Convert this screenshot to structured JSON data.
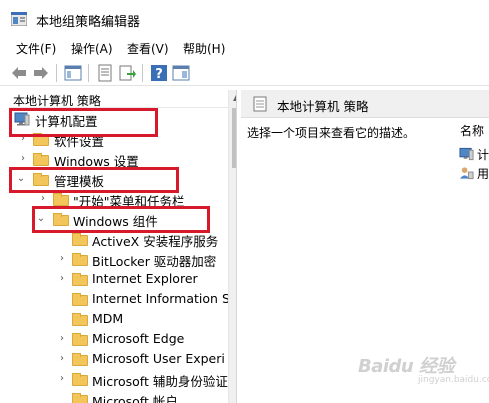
{
  "window": {
    "title": "本地组策略编辑器"
  },
  "menu": [
    "文件(F)",
    "操作(A)",
    "查看(V)",
    "帮助(H)"
  ],
  "left_pane": {
    "header": "本地计算机 策略",
    "tree": [
      {
        "label": "计算机配置",
        "icon": "computer-icon",
        "expander": ""
      },
      {
        "label": "软件设置",
        "icon": "folder-icon",
        "expander": "chevron-right"
      },
      {
        "label": "Windows 设置",
        "icon": "folder-icon",
        "expander": "chevron-right"
      },
      {
        "label": "管理模板",
        "icon": "folder-icon",
        "expander": "chevron-down"
      },
      {
        "label": "\"开始\"菜单和任务栏",
        "icon": "folder-icon",
        "expander": "chevron-right"
      },
      {
        "label": "Windows 组件",
        "icon": "folder-icon",
        "expander": "chevron-down"
      },
      {
        "label": "ActiveX 安装程序服务",
        "icon": "folder-icon",
        "expander": ""
      },
      {
        "label": "BitLocker 驱动器加密",
        "icon": "folder-icon",
        "expander": "chevron-right"
      },
      {
        "label": "Internet Explorer",
        "icon": "folder-icon",
        "expander": "chevron-right"
      },
      {
        "label": "Internet Information S",
        "icon": "folder-icon",
        "expander": ""
      },
      {
        "label": "MDM",
        "icon": "folder-icon",
        "expander": ""
      },
      {
        "label": "Microsoft Edge",
        "icon": "folder-icon",
        "expander": "chevron-right"
      },
      {
        "label": "Microsoft User Experi",
        "icon": "folder-icon",
        "expander": "chevron-right"
      },
      {
        "label": "Microsoft 辅助身份验证",
        "icon": "folder-icon",
        "expander": "chevron-right"
      },
      {
        "label": "Microsoft 帐户",
        "icon": "folder-icon",
        "expander": ""
      }
    ]
  },
  "right_pane": {
    "title": "本地计算机 策略",
    "description": "选择一个项目来查看它的描述。",
    "column": "名称",
    "items": [
      {
        "label": "计",
        "icon": "computer-icon"
      },
      {
        "label": "用",
        "icon": "user-icon"
      }
    ]
  },
  "watermark": {
    "text": "Baidu 经验",
    "sub": "jingyan.baidu.com"
  },
  "colors": {
    "highlight": "#d8192b",
    "folder": "#f2c65a",
    "header_bg": "#f0f0f0"
  }
}
